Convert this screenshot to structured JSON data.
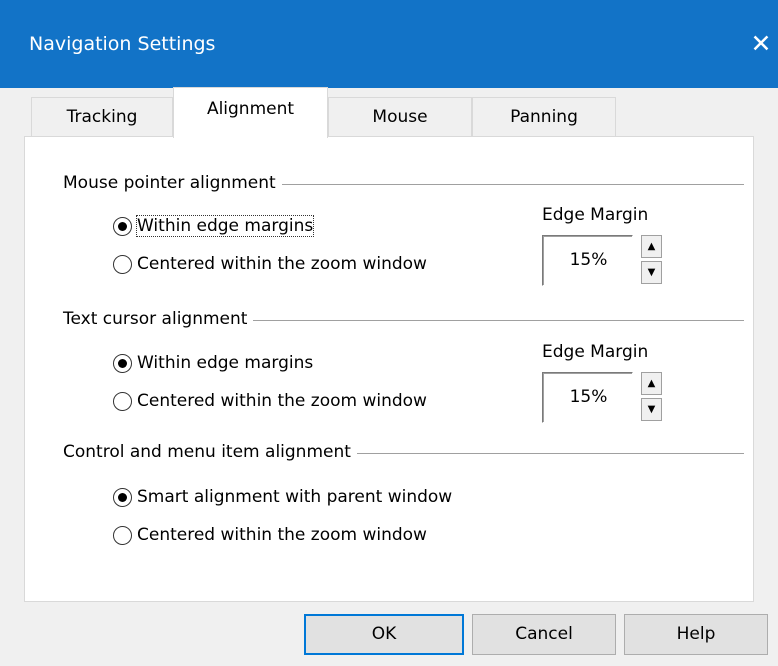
{
  "dialog": {
    "title": "Navigation Settings",
    "close_glyph": "✕"
  },
  "tabs": [
    {
      "label": "Tracking",
      "active": false
    },
    {
      "label": "Alignment",
      "active": true
    },
    {
      "label": "Mouse",
      "active": false
    },
    {
      "label": "Panning",
      "active": false
    }
  ],
  "mouse_group": {
    "title": "Mouse pointer alignment",
    "option_edges": "Within edge margins",
    "option_center": "Centered within the zoom window",
    "selected": "option_edges",
    "edge_margin_label": "Edge Margin",
    "edge_margin_value": "15%"
  },
  "text_group": {
    "title": "Text cursor alignment",
    "option_edges": "Within edge margins",
    "option_center": "Centered within the zoom window",
    "selected": "option_edges",
    "edge_margin_label": "Edge Margin",
    "edge_margin_value": "15%"
  },
  "control_group": {
    "title": "Control and menu item alignment",
    "option_smart": "Smart alignment with parent window",
    "option_center": "Centered within the zoom window",
    "selected": "option_smart"
  },
  "buttons": {
    "ok": "OK",
    "cancel": "Cancel",
    "help": "Help"
  },
  "colors": {
    "titlebar": "#1273c7",
    "default_button_border": "#0078d7"
  },
  "icons": {
    "close": "close-icon",
    "spin_up": "arrow-up-icon",
    "spin_down": "arrow-down-icon"
  }
}
